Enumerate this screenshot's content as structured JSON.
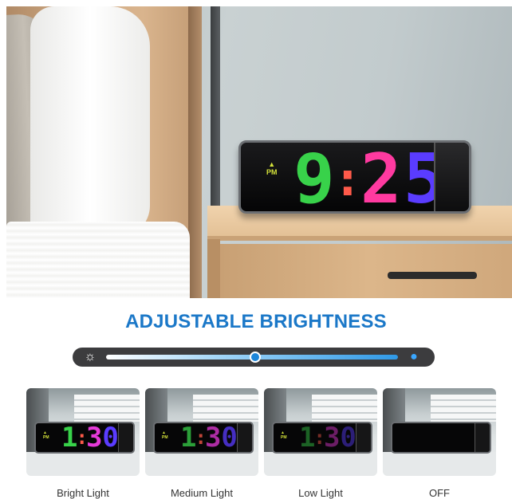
{
  "hero": {
    "clock_time": {
      "hour": "9",
      "colon": ":",
      "min1": "2",
      "min2": "5"
    },
    "clock_indicator": "PM"
  },
  "heading": "ADJUSTABLE BRIGHTNESS",
  "slider": {
    "low_icon": "dim-sun-icon",
    "high_icon": "bright-bulb-icon",
    "level_fraction": 0.51,
    "fill_color": "#2f99e6"
  },
  "thumbnails": [
    {
      "label": "Bright Light",
      "time": {
        "hour": "1",
        "colon": ":",
        "min1": "3",
        "min2": "0"
      },
      "indicator": "PM",
      "brightness": 1.0
    },
    {
      "label": "Medium Light",
      "time": {
        "hour": "1",
        "colon": ":",
        "min1": "3",
        "min2": "0"
      },
      "indicator": "PM",
      "brightness": 0.75
    },
    {
      "label": "Low Light",
      "time": {
        "hour": "1",
        "colon": ":",
        "min1": "3",
        "min2": "0"
      },
      "indicator": "PM",
      "brightness": 0.45
    },
    {
      "label": "OFF",
      "time": {
        "hour": "",
        "colon": "",
        "min1": "",
        "min2": ""
      },
      "indicator": "",
      "brightness": 0.0
    }
  ],
  "colors": {
    "heading": "#1b78c8",
    "digit_green": "#38d24a",
    "digit_pink": "#ff3aa0",
    "digit_magenta": "#e53ad8",
    "digit_violet": "#5a3cff"
  }
}
